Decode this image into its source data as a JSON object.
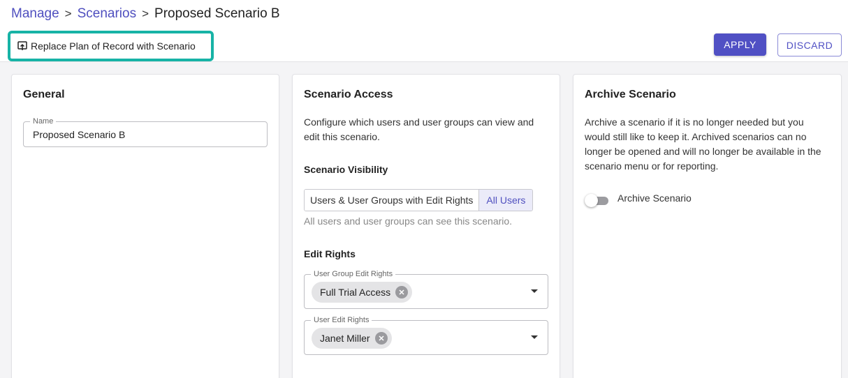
{
  "breadcrumb": {
    "items": [
      "Manage",
      "Scenarios"
    ],
    "current": "Proposed Scenario B",
    "separator": ">"
  },
  "toolbar": {
    "replace_label": "Replace Plan of Record with Scenario",
    "replace_icon": "replace-plan-icon",
    "apply_label": "APPLY",
    "discard_label": "DISCARD"
  },
  "general": {
    "title": "General",
    "name_label": "Name",
    "name_value": "Proposed Scenario B"
  },
  "access": {
    "title": "Scenario Access",
    "description_lines": [
      "Configure which users and user groups can view and",
      "edit this scenario."
    ],
    "visibility_heading": "Scenario Visibility",
    "visibility_options": [
      "Users & User Groups with Edit Rights",
      "All Users"
    ],
    "visibility_selected": "All Users",
    "visibility_hint": "All users and user groups can see this scenario.",
    "edit_rights_heading": "Edit Rights",
    "group_field_label": "User Group Edit Rights",
    "group_chip": "Full Trial Access",
    "user_field_label": "User Edit Rights",
    "user_chip": "Janet Miller"
  },
  "archive": {
    "title": "Archive Scenario",
    "description_lines": [
      "Archive a scenario if it is no longer needed but you",
      "would still like to keep it. Archived scenarios can no",
      "longer be opened and will no longer be available in the",
      "scenario menu or for reporting."
    ],
    "toggle_label": "Archive Scenario",
    "toggle_on": false
  },
  "colors": {
    "accent": "#5050c4",
    "highlight_border": "#17b3a6"
  }
}
